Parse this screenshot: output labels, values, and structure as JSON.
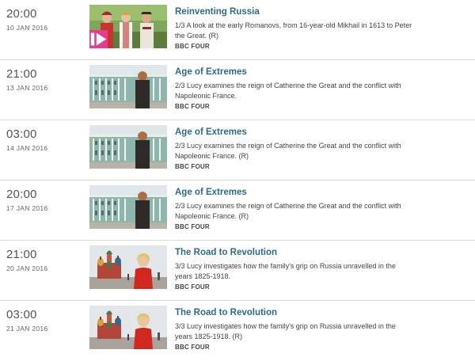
{
  "listings": [
    {
      "time": "20:00",
      "date": "10 JAN 2016",
      "title": "Reinventing Russia",
      "description": "1/3 A look at the early Romanovs, from 16-year-old Mikhail in 1613 to Peter the Great. (R)",
      "channel": "BBC FOUR",
      "thumbnail": "family-portrait",
      "has_iplayer_badge": true
    },
    {
      "time": "21:00",
      "date": "13 JAN 2016",
      "title": "Age of Extremes",
      "description": "2/3 Lucy examines the reign of Catherine the Great and the conflict with Napoleonic France.",
      "channel": "BBC FOUR",
      "thumbnail": "winter-palace",
      "has_iplayer_badge": false
    },
    {
      "time": "03:00",
      "date": "14 JAN 2016",
      "title": "Age of Extremes",
      "description": "2/3 Lucy examines the reign of Catherine the Great and the conflict with Napoleonic France. (R)",
      "channel": "BBC FOUR",
      "thumbnail": "winter-palace",
      "has_iplayer_badge": false
    },
    {
      "time": "20:00",
      "date": "17 JAN 2016",
      "title": "Age of Extremes",
      "description": "2/3 Lucy examines the reign of Catherine the Great and the conflict with Napoleonic France. (R)",
      "channel": "BBC FOUR",
      "thumbnail": "winter-palace",
      "has_iplayer_badge": false
    },
    {
      "time": "21:00",
      "date": "20 JAN 2016",
      "title": "The Road to Revolution",
      "description": "3/3 Lucy investigates how the family's grip on Russia unravelled in the years 1825-1918.",
      "channel": "BBC FOUR",
      "thumbnail": "red-square",
      "has_iplayer_badge": false
    },
    {
      "time": "03:00",
      "date": "21 JAN 2016",
      "title": "The Road to Revolution",
      "description": "3/3 Lucy investigates how the family's grip on Russia unravelled in the years 1825-1918. (R)",
      "channel": "BBC FOUR",
      "thumbnail": "red-square",
      "has_iplayer_badge": false
    }
  ],
  "colors": {
    "title": "#2d6b88",
    "divider": "#dcdcdc",
    "iplayer_badge": "#e53e8c"
  }
}
